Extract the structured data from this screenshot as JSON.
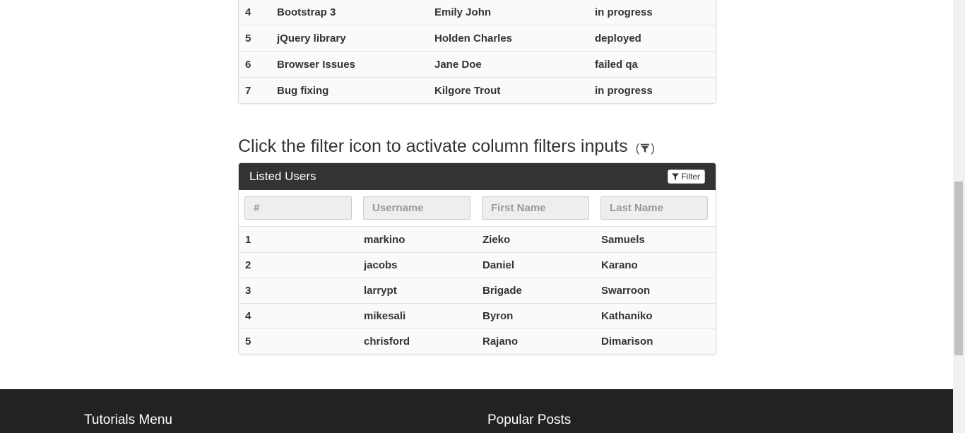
{
  "top_table": {
    "rows": [
      [
        "4",
        "Bootstrap 3",
        "Emily John",
        "in progress"
      ],
      [
        "5",
        "jQuery library",
        "Holden Charles",
        "deployed"
      ],
      [
        "6",
        "Browser Issues",
        "Jane Doe",
        "failed qa"
      ],
      [
        "7",
        "Bug fixing",
        "Kilgore Trout",
        "in progress"
      ]
    ]
  },
  "filter_section": {
    "heading": "Click the filter icon to activate column filters inputs",
    "hint_open": "(",
    "hint_close": ")"
  },
  "users_panel": {
    "title": "Listed Users",
    "filter_button_label": "Filter",
    "filter_placeholders": [
      "#",
      "Username",
      "First Name",
      "Last Name"
    ],
    "rows": [
      [
        "1",
        "markino",
        "Zieko",
        "Samuels"
      ],
      [
        "2",
        "jacobs",
        "Daniel",
        "Karano"
      ],
      [
        "3",
        "larrypt",
        "Brigade",
        "Swarroon"
      ],
      [
        "4",
        "mikesali",
        "Byron",
        "Kathaniko"
      ],
      [
        "5",
        "chrisford",
        "Rajano",
        "Dimarison"
      ]
    ]
  },
  "footer": {
    "left_heading": "Tutorials Menu",
    "right_heading": "Popular Posts"
  },
  "colors": {
    "panel_header_bg": "#333333",
    "footer_bg": "#222222"
  }
}
